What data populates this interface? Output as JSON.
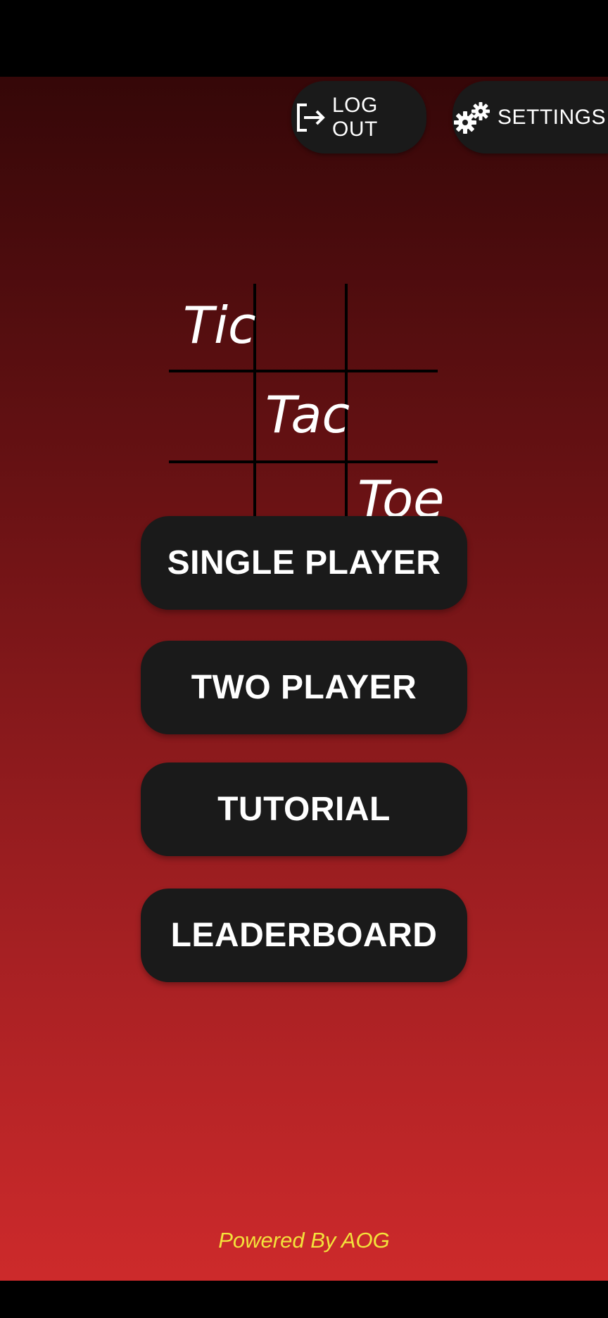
{
  "header": {
    "logout_label": "LOG OUT",
    "logout_icon": "logout-icon",
    "settings_label": "SETTINGS",
    "settings_icon": "gears-icon"
  },
  "logo": {
    "words": [
      "Tic",
      "Tac",
      "Toe"
    ]
  },
  "menu": {
    "single_player": "SINGLE PLAYER",
    "two_player": "TWO PLAYER",
    "tutorial": "TUTORIAL",
    "leaderboard": "LEADERBOARD"
  },
  "footer": {
    "text": "Powered By AOG"
  },
  "colors": {
    "button_bg": "#1a1a1a",
    "gradient_top": "#350708",
    "gradient_bottom": "#cd2a2b",
    "footer_text": "#f3e23b"
  }
}
